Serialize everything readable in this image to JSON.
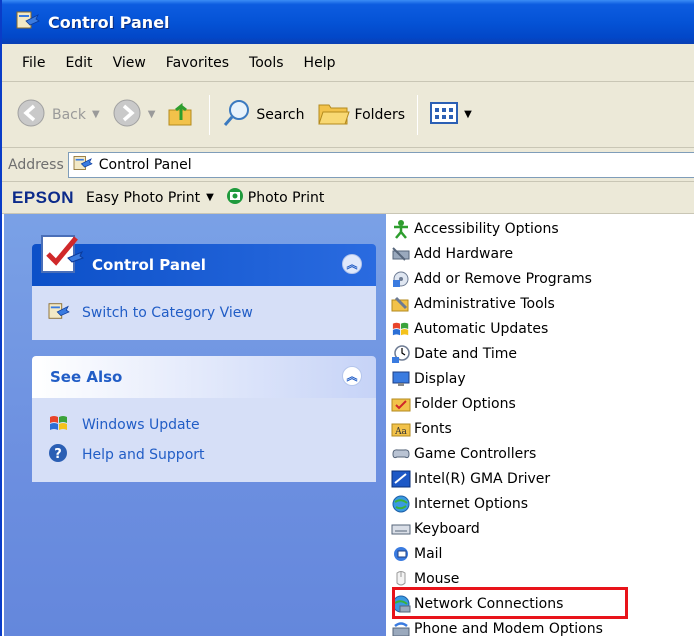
{
  "window": {
    "title": "Control Panel"
  },
  "menu": [
    "File",
    "Edit",
    "View",
    "Favorites",
    "Tools",
    "Help"
  ],
  "toolbar": {
    "back": "Back",
    "search": "Search",
    "folders": "Folders"
  },
  "address": {
    "label": "Address",
    "value": "Control Panel"
  },
  "epson": {
    "logo": "EPSON",
    "easy_photo_print": "Easy Photo Print",
    "photo_print": "Photo Print"
  },
  "taskpane": {
    "control_panel": {
      "title": "Control Panel",
      "switch_view": "Switch to Category View"
    },
    "see_also": {
      "title": "See Also",
      "windows_update": "Windows Update",
      "help_support": "Help and Support"
    }
  },
  "items": [
    {
      "label": "Accessibility Options",
      "icon": "accessibility-icon"
    },
    {
      "label": "Add Hardware",
      "icon": "add-hardware-icon"
    },
    {
      "label": "Add or Remove Programs",
      "icon": "add-remove-programs-icon"
    },
    {
      "label": "Administrative Tools",
      "icon": "administrative-tools-icon"
    },
    {
      "label": "Automatic Updates",
      "icon": "automatic-updates-icon"
    },
    {
      "label": "Date and Time",
      "icon": "date-time-icon"
    },
    {
      "label": "Display",
      "icon": "display-icon"
    },
    {
      "label": "Folder Options",
      "icon": "folder-options-icon"
    },
    {
      "label": "Fonts",
      "icon": "fonts-icon"
    },
    {
      "label": "Game Controllers",
      "icon": "game-controllers-icon"
    },
    {
      "label": "Intel(R) GMA Driver",
      "icon": "intel-gma-icon"
    },
    {
      "label": "Internet Options",
      "icon": "internet-options-icon"
    },
    {
      "label": "Keyboard",
      "icon": "keyboard-icon"
    },
    {
      "label": "Mail",
      "icon": "mail-icon"
    },
    {
      "label": "Mouse",
      "icon": "mouse-icon"
    },
    {
      "label": "Network Connections",
      "icon": "network-connections-icon"
    },
    {
      "label": "Phone and Modem Options",
      "icon": "phone-modem-icon"
    }
  ],
  "colors": {
    "highlight": "#e8131a",
    "link": "#215dc6",
    "titlebar": "#0553d6"
  }
}
